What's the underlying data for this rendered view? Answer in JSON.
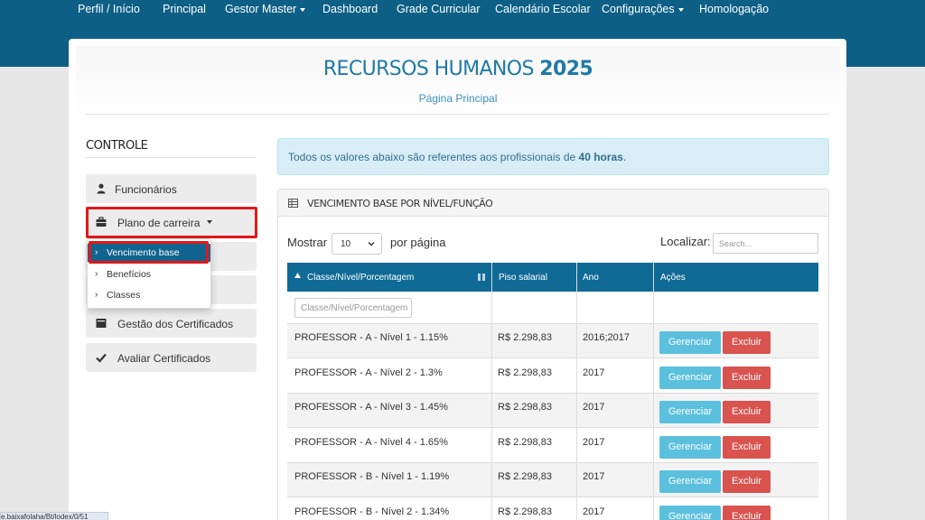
{
  "nav": {
    "items": [
      {
        "label": "Perfil / Início",
        "dropdown": false
      },
      {
        "label": "Principal",
        "dropdown": false
      },
      {
        "label": "Gestor Master",
        "dropdown": true
      },
      {
        "label": "Dashboard",
        "dropdown": false
      },
      {
        "label": "Grade Curricular",
        "dropdown": false
      },
      {
        "label": "Calendário Escolar",
        "dropdown": false
      },
      {
        "label": "Configurações",
        "dropdown": true
      },
      {
        "label": "Homologação",
        "dropdown": false
      }
    ]
  },
  "header": {
    "title_main": "RECURSOS HUMANOS",
    "title_year": "2025",
    "subtitle": "Página Principal"
  },
  "sidebar": {
    "heading": "CONTROLE",
    "items": [
      {
        "label": "Funcionários",
        "icon": "user-icon"
      },
      {
        "label": "Plano de carreira",
        "icon": "briefcase-icon"
      },
      {
        "label": "Gestão dos Certificados",
        "icon": "certificate-icon"
      },
      {
        "label": "Avaliar Certificados",
        "icon": "check-icon"
      }
    ],
    "submenu": [
      {
        "label": "Vencimento base",
        "active": true
      },
      {
        "label": "Benefícios",
        "active": false
      },
      {
        "label": "Classes",
        "active": false
      }
    ]
  },
  "alert": {
    "text": "Todos os valores abaixo são referentes aos profissionais de ",
    "bold": "40 horas",
    "end": "."
  },
  "panel": {
    "title": "VENCIMENTO BASE POR NÍVEL/FUNÇÃO",
    "length_prefix": "Mostrar",
    "length_value": "10",
    "length_suffix": "por página",
    "search_label": "Localizar:",
    "search_placeholder": "Search...",
    "filter_placeholder": "Classe/Nível/Porcentagem"
  },
  "table": {
    "columns": [
      "Classe/Nível/Porcentagem",
      "Piso salarial",
      "Ano",
      "Ações"
    ],
    "action_manage": "Gerenciar",
    "action_delete": "Excluir",
    "rows": [
      {
        "classe": "PROFESSOR - A - Nível 1 - 1.15%",
        "piso": "R$ 2.298,83",
        "ano": "2016;2017"
      },
      {
        "classe": "PROFESSOR - A - Nível 2 - 1.3%",
        "piso": "R$ 2.298,83",
        "ano": "2017"
      },
      {
        "classe": "PROFESSOR - A - Nível 3 - 1.45%",
        "piso": "R$ 2.298,83",
        "ano": "2017"
      },
      {
        "classe": "PROFESSOR - A - Nível 4 - 1.65%",
        "piso": "R$ 2.298,83",
        "ano": "2017"
      },
      {
        "classe": "PROFESSOR - B - Nível 1 - 1.19%",
        "piso": "R$ 2.298,83",
        "ano": "2017"
      },
      {
        "classe": "PROFESSOR - B - Nível 2 - 1.34%",
        "piso": "R$ 2.298,83",
        "ano": "2017"
      }
    ]
  },
  "status_bar": {
    "text": "e.baixafolaha/Bt/lodex/0/51"
  },
  "colors": {
    "topbar": "#0d5f85",
    "table_header": "#0f6a96",
    "manage_button": "#5bc0de",
    "delete_button": "#d9534f",
    "highlight": "#e11818"
  }
}
